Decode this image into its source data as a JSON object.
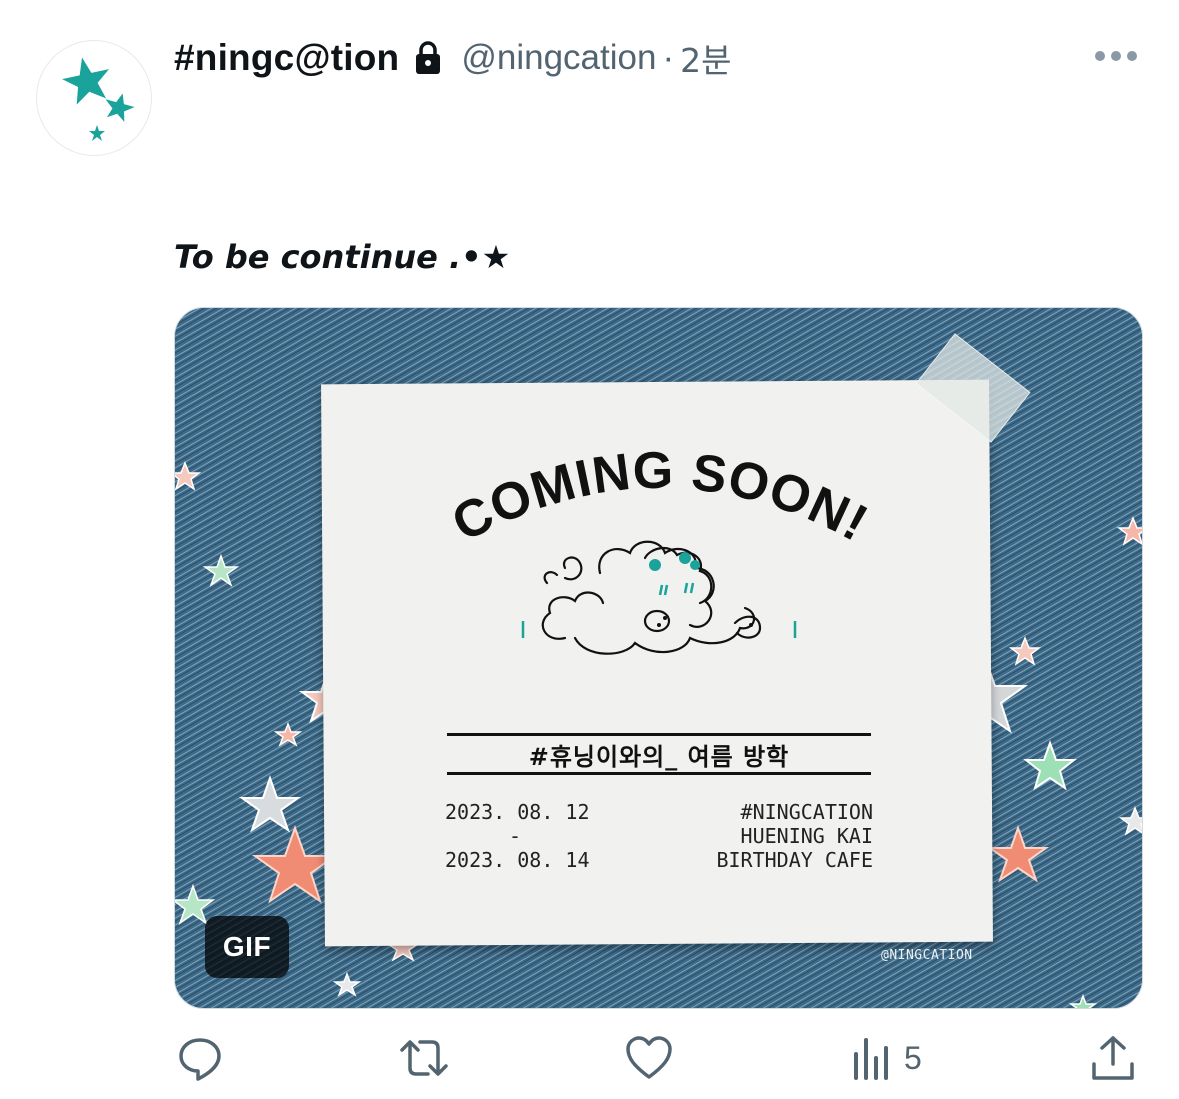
{
  "author": {
    "display_name": "#ningc@tion",
    "handle": "@ningcation",
    "separator": "·",
    "time": "2분",
    "protected_icon": "lock-icon",
    "avatar_icon": "stars-avatar"
  },
  "tweet": {
    "text": "To be continue .•★"
  },
  "media": {
    "type": "gif",
    "badge": "GIF",
    "poster": {
      "headline": "COMING SOON!",
      "subtitle": "#휴닝이와의_ 여름 방학",
      "date_start": "2023. 08. 12",
      "date_sep": "-",
      "date_end": "2023. 08. 14",
      "event_line1": "#NINGCATION",
      "event_line2": "HUENING KAI",
      "event_line3": "BIRTHDAY CAFE",
      "watermark": "@NINGCATION"
    }
  },
  "actions": {
    "reply_icon": "reply-icon",
    "retweet_icon": "retweet-icon",
    "like_icon": "heart-icon",
    "views_icon": "views-icon",
    "views_count": "5",
    "share_icon": "share-icon"
  },
  "colors": {
    "text_primary": "#0f1419",
    "text_secondary": "#536471",
    "avatar_star": "#1aa39a",
    "denim": "#3f6d8c"
  }
}
